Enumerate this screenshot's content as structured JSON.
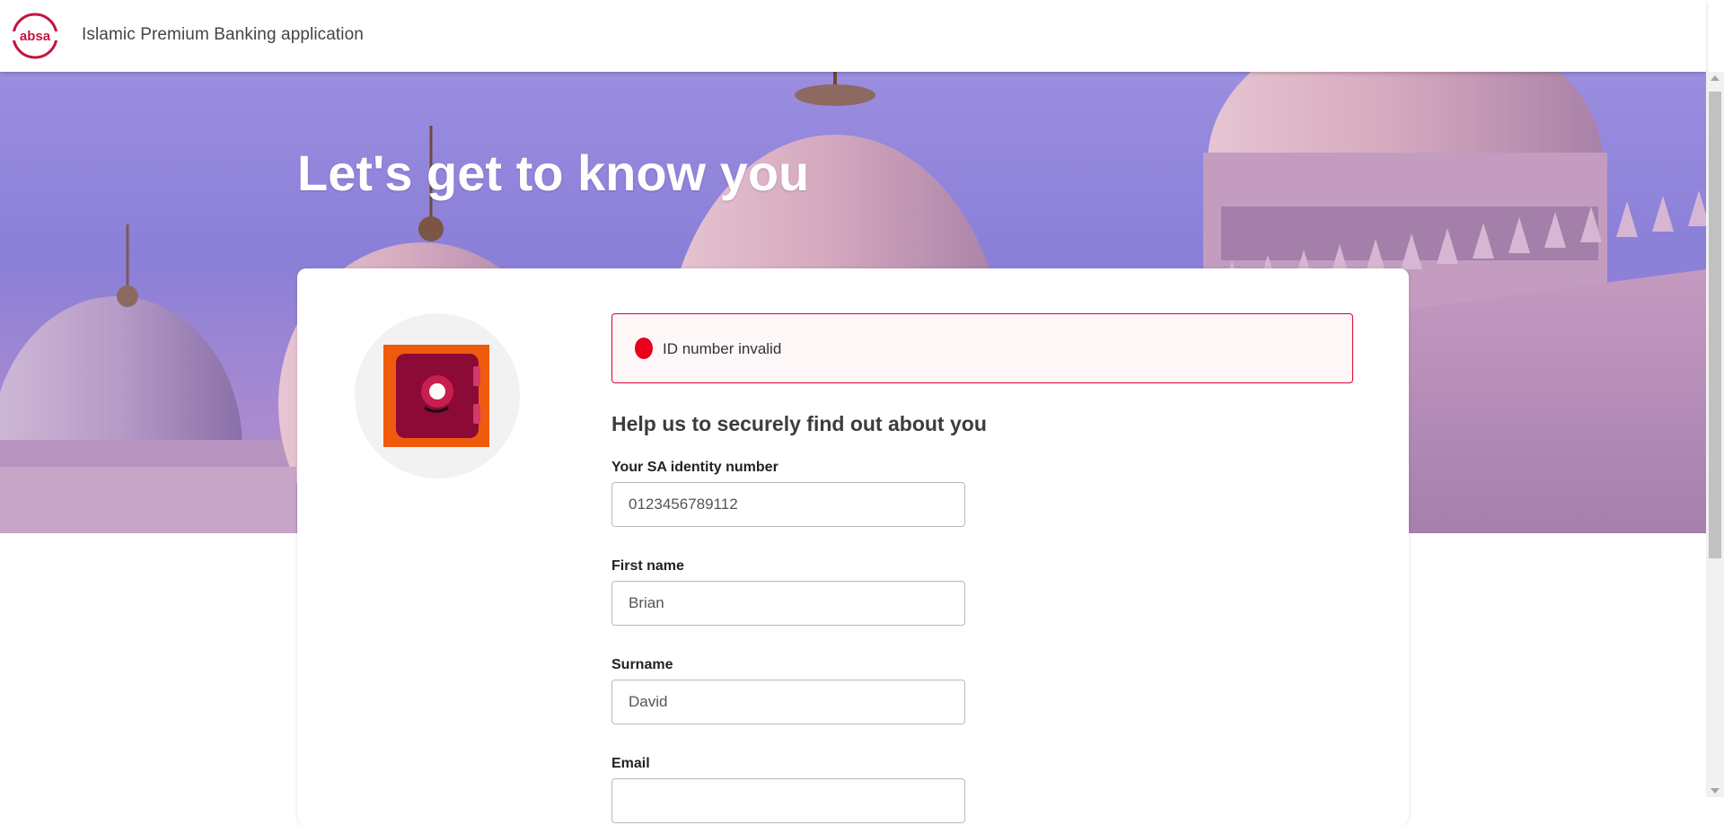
{
  "header": {
    "logo_text": "absa",
    "app_title": "Islamic Premium Banking application"
  },
  "hero": {
    "title": "Let's get to know you"
  },
  "alert": {
    "message": "ID number invalid",
    "color": "#e8001c"
  },
  "form": {
    "section_title": "Help us to securely find out about you",
    "fields": [
      {
        "label": "Your SA identity number",
        "value": "0123456789112"
      },
      {
        "label": "First name",
        "value": "Brian"
      },
      {
        "label": "Surname",
        "value": "David"
      },
      {
        "label": "Email",
        "value": ""
      }
    ]
  },
  "colors": {
    "brand": "#af144b",
    "alert_border": "#dc0032"
  },
  "icons": {
    "illustration": "safe-icon",
    "alert": "error-dot-icon"
  }
}
